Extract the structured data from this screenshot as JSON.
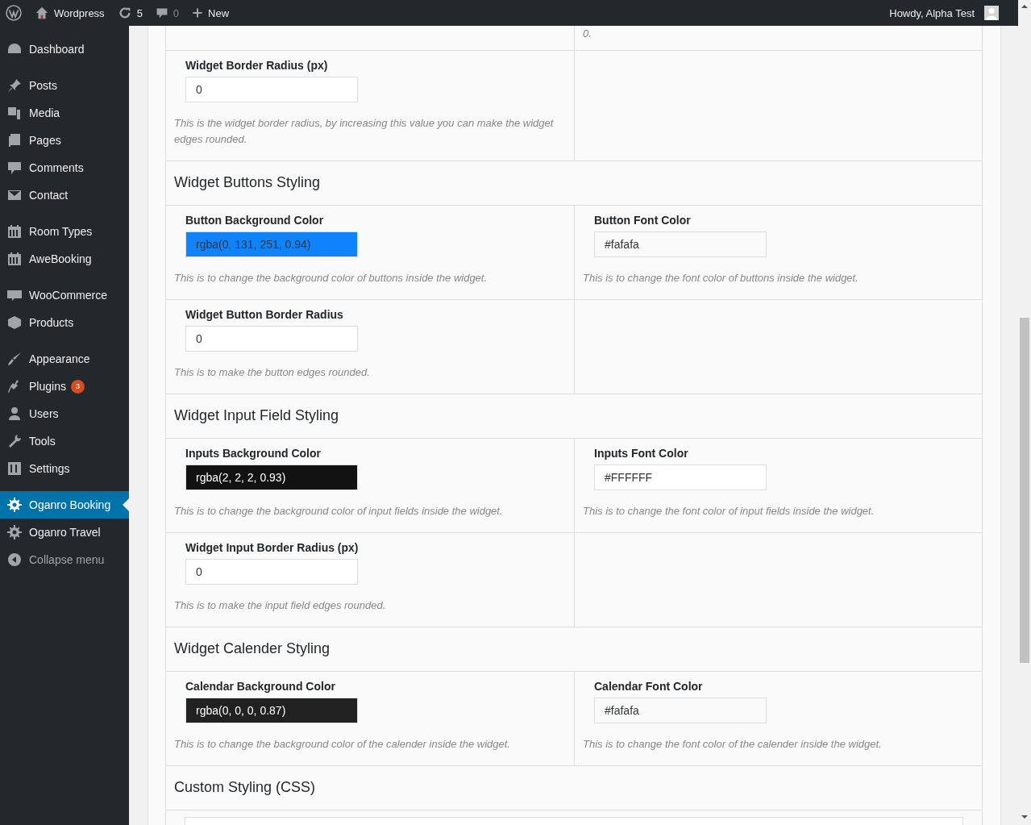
{
  "admin_bar": {
    "site_name": "Wordpress",
    "updates": "5",
    "comments": "0",
    "new_label": "New",
    "greeting": "Howdy, Alpha Test"
  },
  "sidebar": {
    "groups": [
      [
        {
          "label": "Dashboard",
          "selected": false
        }
      ],
      [
        {
          "label": "Posts",
          "selected": false
        },
        {
          "label": "Media",
          "selected": false
        },
        {
          "label": "Pages",
          "selected": false
        },
        {
          "label": "Comments",
          "selected": false
        },
        {
          "label": "Contact",
          "selected": false
        }
      ],
      [
        {
          "label": "Room Types",
          "selected": false
        },
        {
          "label": "AweBooking",
          "selected": false
        }
      ],
      [
        {
          "label": "WooCommerce",
          "selected": false
        },
        {
          "label": "Products",
          "selected": false
        }
      ],
      [
        {
          "label": "Appearance",
          "selected": false
        },
        {
          "label": "Plugins",
          "selected": false,
          "badge": "3"
        },
        {
          "label": "Users",
          "selected": false
        },
        {
          "label": "Tools",
          "selected": false
        },
        {
          "label": "Settings",
          "selected": false
        }
      ],
      [
        {
          "label": "Oganro Booking",
          "selected": true
        },
        {
          "label": "Oganro Travel",
          "selected": false
        }
      ]
    ],
    "collapse_label": "Collapse menu"
  },
  "top_partial": {
    "right_text": "0."
  },
  "sections": [
    {
      "rows": [
        [
          {
            "label": "Widget Border Radius (px)",
            "value": "0",
            "description": "This is the widget border radius, by increasing this value you can make the widget edges rounded."
          },
          null
        ]
      ]
    },
    {
      "title": "Widget Buttons Styling",
      "rows": [
        [
          {
            "label": "Button Background Color",
            "value": "rgba(0, 131, 251, 0.94)",
            "color": "#0f83fb",
            "description": "This is to change the background color of buttons inside the widget."
          },
          {
            "label": "Button Font Color",
            "value": "#fafafa",
            "color": "#fafafa",
            "description": "This is to change the font color of buttons inside the widget."
          }
        ],
        [
          {
            "label": "Widget Button Border Radius",
            "value": "0",
            "description": "This is to make the button edges rounded."
          },
          null
        ]
      ]
    },
    {
      "title": "Widget Input Field Styling",
      "rows": [
        [
          {
            "label": "Inputs Background Color",
            "value": "rgba(2, 2, 2, 0.93)",
            "color": "#121212",
            "description": "This is to change the background color of input fields inside the widget."
          },
          {
            "label": "Inputs Font Color",
            "value": "#FFFFFF",
            "color": "#ffffff",
            "description": "This is to change the font color of input fields inside the widget."
          }
        ],
        [
          {
            "label": "Widget Input Border Radius (px)",
            "value": "0",
            "description": "This is to make the input field edges rounded."
          },
          null
        ]
      ]
    },
    {
      "title": "Widget Calender Styling",
      "rows": [
        [
          {
            "label": "Calendar Background Color",
            "value": "rgba(0, 0, 0, 0.87)",
            "color": "#212121",
            "description": "This is to change the background color of the calender inside the widget."
          },
          {
            "label": "Calendar Font Color",
            "value": "#fafafa",
            "color": "#fafafa",
            "description": "This is to change the font color of the calender inside the widget."
          }
        ]
      ]
    },
    {
      "title": "Custom Styling (CSS)",
      "kind": "css"
    }
  ]
}
